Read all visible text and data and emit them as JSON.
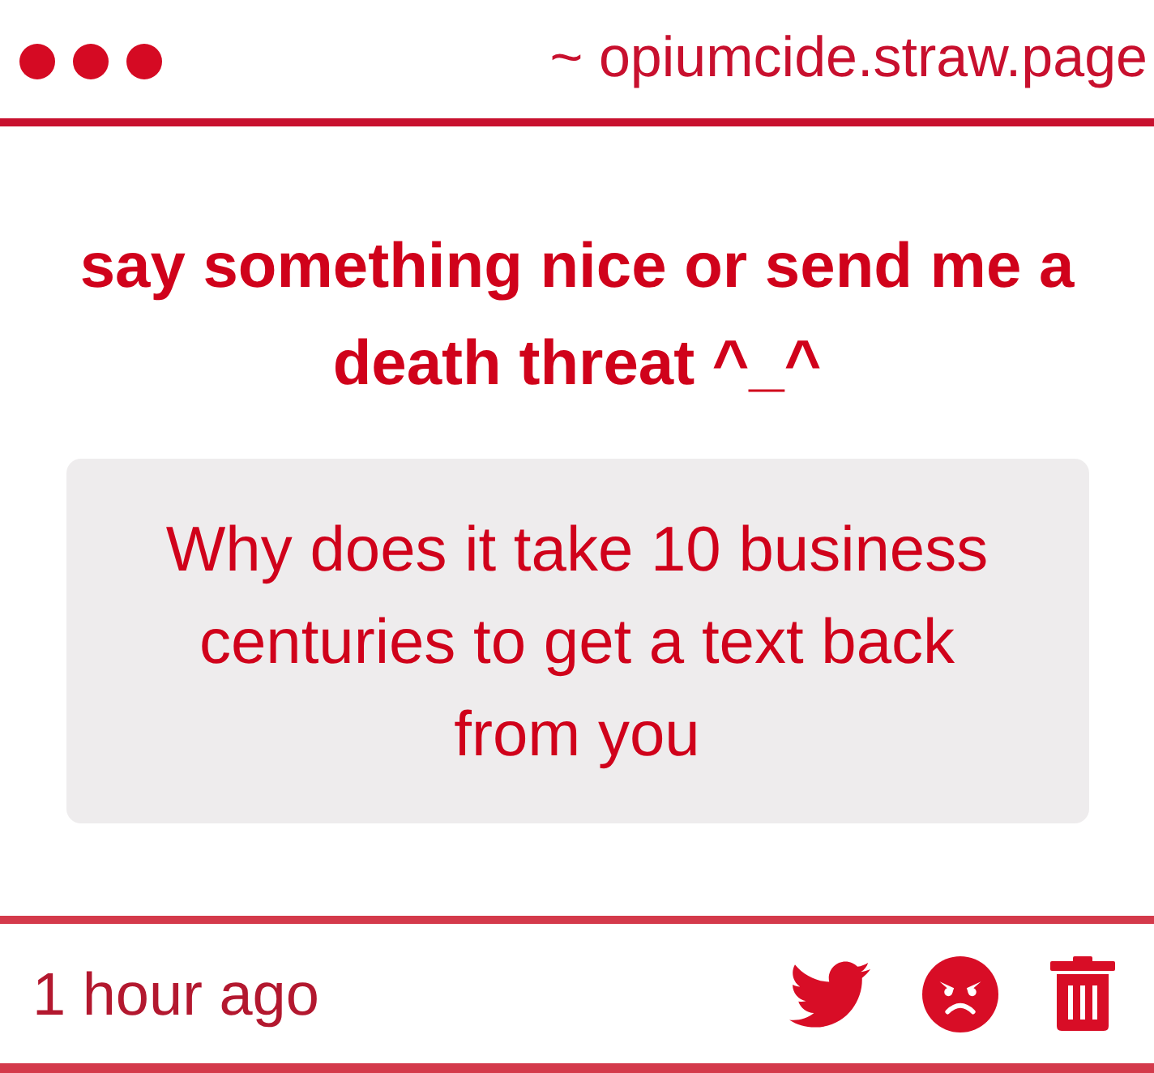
{
  "header": {
    "url": "~ opiumcide.straw.page"
  },
  "prompt": {
    "title": "say something nice or send me a death threat ^_^"
  },
  "message": {
    "text": "Why does it take 10 business centuries to get a text back from you"
  },
  "footer": {
    "time": "1 hour ago",
    "actions": [
      {
        "kind": "twitter"
      },
      {
        "kind": "angry"
      },
      {
        "kind": "delete"
      }
    ]
  }
}
